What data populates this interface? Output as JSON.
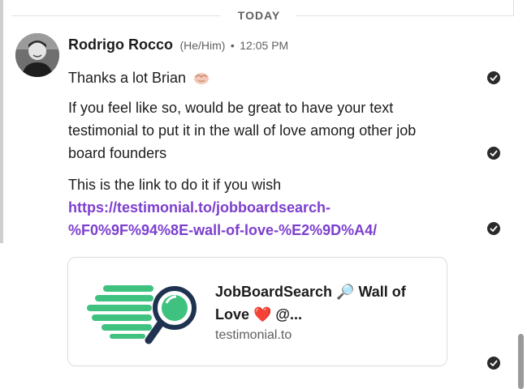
{
  "divider": {
    "label": "TODAY"
  },
  "message": {
    "sender": "Rodrigo Rocco",
    "pronouns": "(He/Him)",
    "separator": "•",
    "time": "12:05 PM",
    "text1": "Thanks a lot Brian",
    "text1_emoji": "handshake-emoji",
    "text2": "If you feel like so, would be great to have your text testimonial to put it in the wall of love among other job board founders",
    "text3_prefix": "This is the link to do it if you wish",
    "text3_link": "https://testimonial.to/jobboardsearch-%F0%9F%94%8E-wall-of-love-%E2%9D%A4/"
  },
  "link_preview": {
    "title": "JobBoardSearch 🔎 Wall of Love ❤️ @...",
    "domain": "testimonial.to",
    "image_icon": "magnifier-logo"
  },
  "colors": {
    "link": "#7c3fcf",
    "meta_text": "#616061",
    "logo_green": "#3fc27f",
    "logo_navy": "#1f3350"
  }
}
